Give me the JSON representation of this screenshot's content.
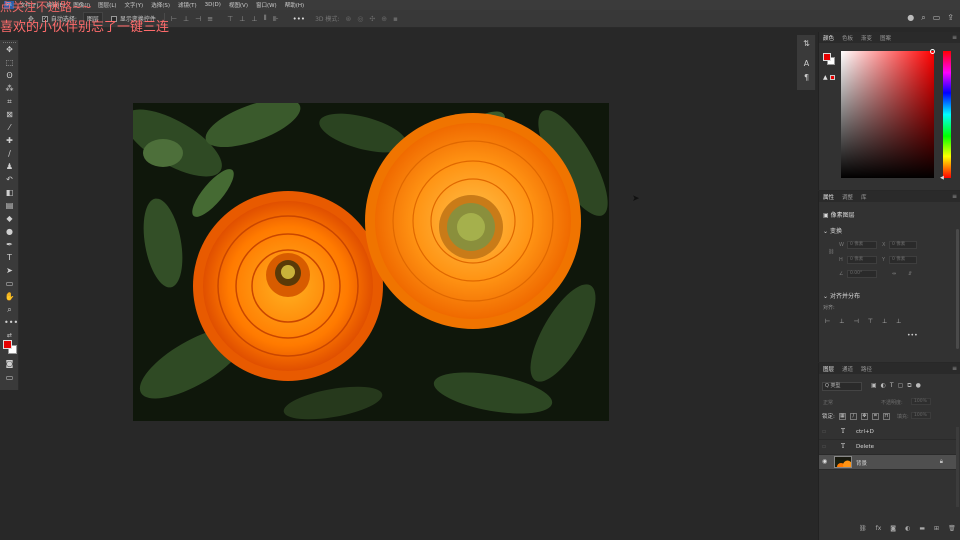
{
  "overlay": {
    "line1": "点关注不迷路~~",
    "line2": "喜欢的小伙伴别忘了一键三连"
  },
  "menu": {
    "items": [
      "文件(F)",
      "编辑(E)",
      "图像(I)",
      "图层(L)",
      "文字(Y)",
      "选择(S)",
      "滤镜(T)",
      "3D(D)",
      "视图(V)",
      "窗口(W)",
      "帮助(H)"
    ]
  },
  "options_bar": {
    "auto_select_label": "自动选择:",
    "auto_select_value": "图层",
    "show_transform_label": "显示变换控件",
    "mode_label": "3D 模式:",
    "more_label": "•••"
  },
  "color_panel": {
    "tabs": [
      "颜色",
      "色板",
      "渐变",
      "图案"
    ],
    "foreground": "#e60000",
    "background": "#ffffff"
  },
  "properties_panel": {
    "tabs": [
      "属性",
      "调整",
      "库"
    ],
    "layer_type": "像素图层",
    "transform_title": "变换",
    "w_label": "W",
    "w_value": "0 像素",
    "x_label": "X",
    "x_value": "0 像素",
    "h_label": "H",
    "h_value": "0 像素",
    "y_label": "Y",
    "y_value": "0 像素",
    "angle_value": "0.00°",
    "align_title": "对齐并分布",
    "align_to_label": "对齐:",
    "more": "•••"
  },
  "layers_panel": {
    "tabs": [
      "图层",
      "通道",
      "路径"
    ],
    "filter_kind": "Q 类型",
    "blend_mode": "正常",
    "opacity_label": "不透明度:",
    "opacity_value": "100%",
    "lock_label": "锁定:",
    "fill_label": "填充:",
    "fill_value": "100%",
    "layers": [
      {
        "name": "ctrl+D",
        "type": "text",
        "visible": false
      },
      {
        "name": "Delete",
        "type": "text",
        "visible": false
      },
      {
        "name": "背景",
        "type": "image",
        "visible": true,
        "selected": true,
        "locked": true
      }
    ]
  }
}
